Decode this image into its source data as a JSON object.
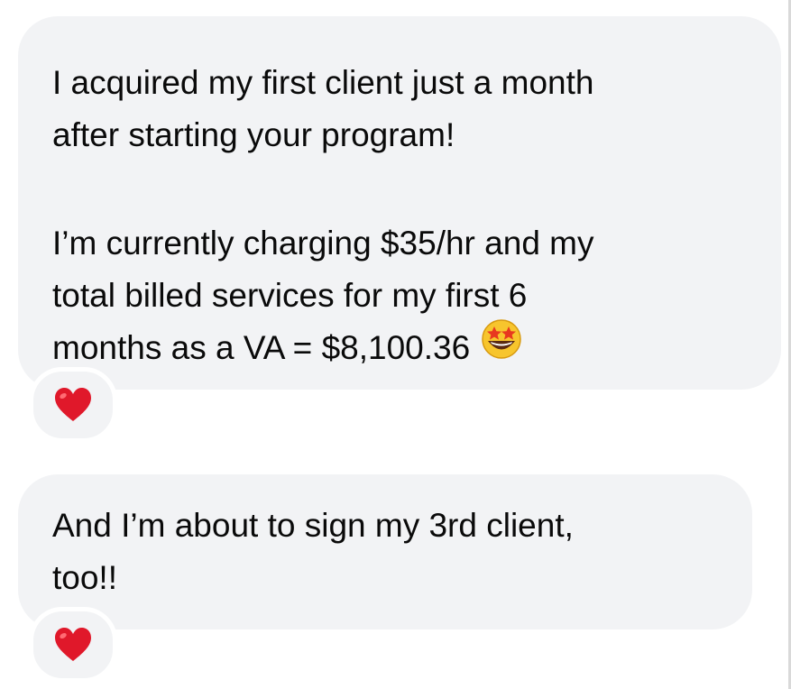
{
  "messages": [
    {
      "lines": [
        "I acquired my first client just a month",
        "after starting your program!",
        "",
        "I’m currently charging $35/hr and my",
        "total billed services for my first 6",
        "months as a VA = $8,100.36"
      ],
      "emoji": "star-struck-emoji",
      "reaction": "red-heart-icon"
    },
    {
      "lines": [
        "And I’m about to sign my 3rd client,",
        "too!!"
      ],
      "reaction": "red-heart-icon"
    }
  ],
  "colors": {
    "bubble": "#f2f3f5",
    "text": "#0a0a0a",
    "heart": "#e0182a",
    "star_emoji_face": "#f7c52d"
  }
}
